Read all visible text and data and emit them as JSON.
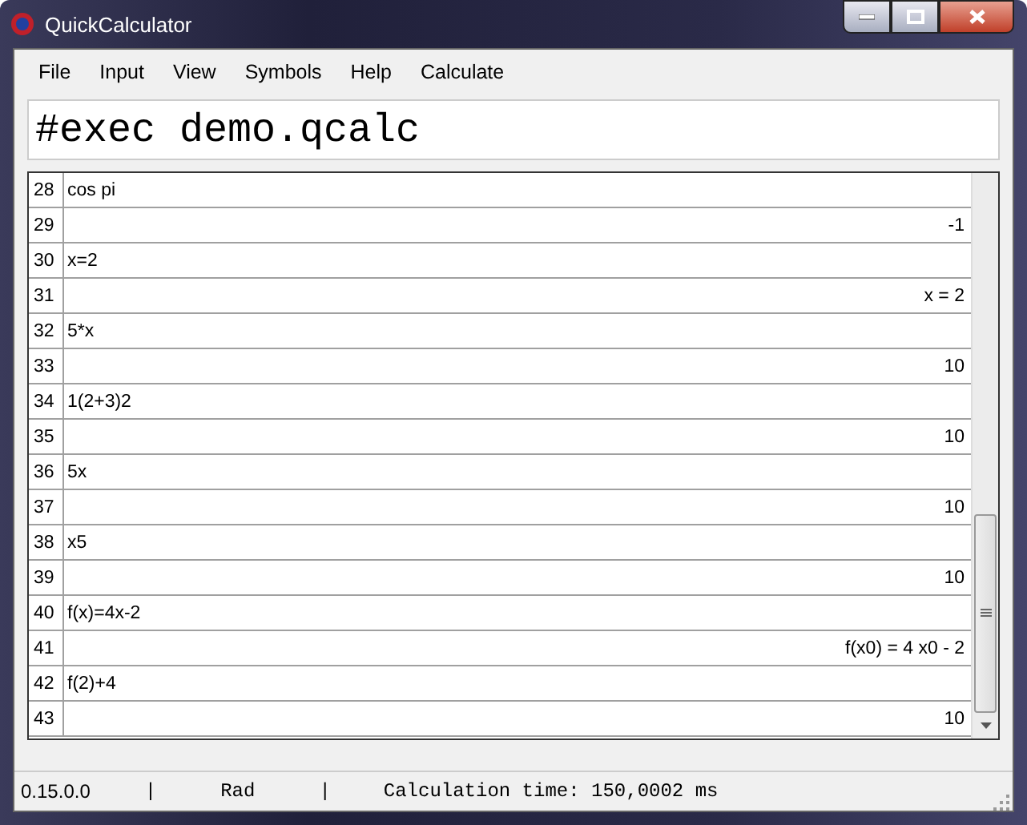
{
  "window": {
    "title": "QuickCalculator"
  },
  "menu": [
    "File",
    "Input",
    "View",
    "Symbols",
    "Help",
    "Calculate"
  ],
  "input": {
    "value": "#exec demo.qcalc"
  },
  "rows": [
    {
      "number": "28",
      "kind": "input",
      "text": "cos pi"
    },
    {
      "number": "29",
      "kind": "output",
      "text": "-1"
    },
    {
      "number": "30",
      "kind": "input",
      "text": "x=2"
    },
    {
      "number": "31",
      "kind": "output",
      "text": "x = 2"
    },
    {
      "number": "32",
      "kind": "input",
      "text": "5*x"
    },
    {
      "number": "33",
      "kind": "output",
      "text": "10"
    },
    {
      "number": "34",
      "kind": "input",
      "text": "1(2+3)2"
    },
    {
      "number": "35",
      "kind": "output",
      "text": "10"
    },
    {
      "number": "36",
      "kind": "input",
      "text": "5x"
    },
    {
      "number": "37",
      "kind": "output",
      "text": "10"
    },
    {
      "number": "38",
      "kind": "input",
      "text": "x5"
    },
    {
      "number": "39",
      "kind": "output",
      "text": "10"
    },
    {
      "number": "40",
      "kind": "input",
      "text": "f(x)=4x-2"
    },
    {
      "number": "41",
      "kind": "output",
      "text": "f(x0) = 4 x0 - 2"
    },
    {
      "number": "42",
      "kind": "input",
      "text": "f(2)+4"
    },
    {
      "number": "43",
      "kind": "output",
      "text": "10"
    }
  ],
  "status_bar": {
    "version": "0.15.0.0",
    "separator_1": "|",
    "angle_mode": "Rad",
    "separator_2": "|",
    "calculation_time": "Calculation time: 150,0002 ms"
  }
}
